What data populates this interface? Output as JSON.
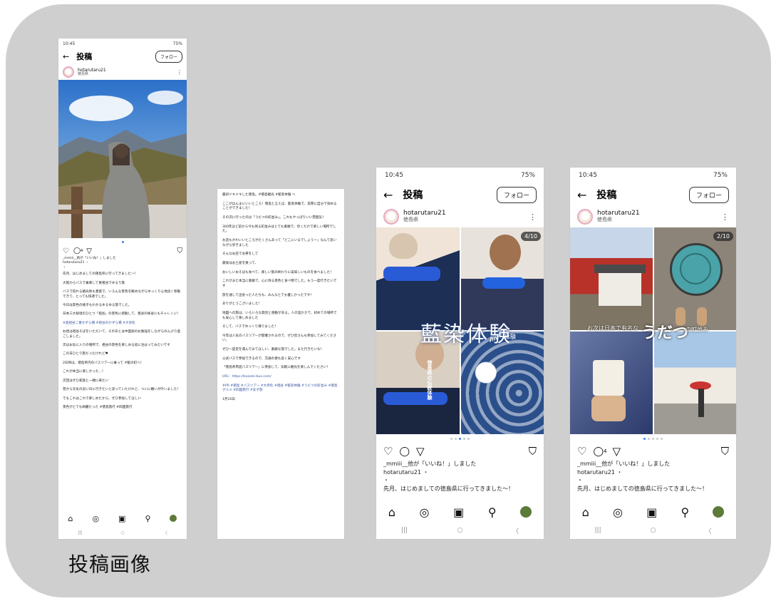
{
  "caption": "投稿画像",
  "p1": {
    "time": "10:45",
    "sys_right": "75%",
    "back": "←",
    "title": "投稿",
    "follow": "フォロー",
    "user": "hotarutaru21",
    "location": "徳島県",
    "more": "⋮",
    "likes": "4",
    "liked_by": "_mmiii__他が「いいね！」しました",
    "author": "hotarutaru21 ・",
    "bullet": "・",
    "lines": [
      "先月、はじめましての徳島県に行ってきました～！",
      "大阪からバスで乗車して東祖谷でゆるり旅",
      "バスで巡れる観光地も豊富で、いろんな景色を眺めながらゆっくり心地良く移動できて、とっても快適でした。",
      "今日は景色の様子もわかるゆるゆる旅でした。",
      "日本三大秘境のひとつ「祖谷」の景色に感動して、祖谷の峡谷にもチャレンジ！",
      "#奥祖谷二重かずら橋 #祖谷のかずら橋 #大歩危",
      "お昼は祖谷そばをいただいて、そのあとは中国語のお勉強をしながらのんびり過ごしました。",
      "次はお気に入りの場所で、祖谷の景色を楽しめる宿に泊まってみたいです",
      "この日ひとり旅だったけれど♥",
      "2日目は、徳島県内のバスツアーに乗って #藍の町へ！",
      "これが本当に楽しかった...！",
      "次回はぜひ家族と一緒に来たい",
      "昔から天気の良い日に行きたいと思っていたけれど、ついに願いが叶いました！",
      "でもこれはこれで楽しめたから、ぜひ参加してほしい",
      "景色がとても綺麗だった #徳島旅行 #四国旅行"
    ]
  },
  "p2": {
    "lines": [
      "最初ドキドキした徳島。#徳島観光 #藍染体験 へ",
      "ここがほんまにいいところ！徳島と言えば、藍染体験で、実際に自分で染めることができました！",
      "その次に行ったのは「うだつの町並み」。これもやっぱりいい雰囲気！",
      "300年ほど前から今も残る町並みはとても素敵で、歩くだけで楽しい場所でした。",
      "お店もかわいいところがたくさんあって「どこにいるでしょう～」なんて思いながら歩きました",
      "そんなお店でお茶をして",
      "最後はお土産を買って、",
      "おいしいおそばも食べて、楽しい旅の終わりに美味しいものを食べました！",
      "これがまた本当に素敵で、心に残る景色と食べ物でした。もう一度行きたいです",
      "旅を通して出会った人たちも、みんなとても優しかったです！",
      "ありがとうございました！",
      "地図への旅は、いろいろな発見と感動がある。人の温かさで、初めての場所でも安心して楽しめました",
      "そして、バスでゆっくり帰りました！",
      "今年は人気のバスツアーが開催されるので、ぜひ皆さんも参加してみてください。",
      "ぜひ一度足を運んでみてほしい、素敵な旅でした。また行きたいな！",
      "公式バスで参加できるので、交通の便も良く安心です",
      "「徳島県周遊バスツアー」に参加して、気軽に観光を楽しんでください！",
      "URL：https://kaiseki-bus.com/",
      "#PR #徳島 #バスツアー #大歩危 #祖谷 #藍染体験 #うだつの町並み #徳島グルメ #四国旅行 #女子旅",
      "1月10日"
    ]
  },
  "p3": {
    "time": "10:45",
    "sys_right": "75%",
    "back": "←",
    "title": "投稿",
    "follow": "フォロー",
    "user": "hotarutaru21",
    "location": "徳島県",
    "more": "⋮",
    "counter": "4/10",
    "overlay_small": "徳島県の伝統体験",
    "overlay_big": "藍染体験",
    "overlay_side": "体験",
    "likes": "",
    "liked_by": "_mmiii__他が「いいね！」しました",
    "author": "hotarutaru21 ・",
    "bullet": "・",
    "caption": "先月、はじめましての徳島県に行ってきました～！"
  },
  "p4": {
    "time": "10:45",
    "sys_right": "75%",
    "back": "←",
    "title": "投稿",
    "follow": "フォロー",
    "user": "hotarutaru21",
    "location": "徳島県",
    "more": "⋮",
    "counter": "2/10",
    "overlay_small": "お次は日本で有名な",
    "overlay_big": "うだつ",
    "overlay_side": "の町並み",
    "likes": "4",
    "liked_by": "_mmiii__他が「いいね！」しました",
    "author": "hotarutaru21 ・",
    "bullet": "・",
    "caption": "先月、はじめましての徳島県に行ってきました～！"
  },
  "icons": {
    "heart": "♡",
    "comment": "◯",
    "send": "▽",
    "bookmark": "⛉",
    "home": "⌂",
    "messenger": "◎",
    "reels": "▣",
    "search": "⚲",
    "recent": "|||",
    "homekey": "○",
    "backkey": "〈"
  },
  "colors": {
    "panel": "#d0cfcf",
    "accent_blue": "#3b82f6",
    "link_blue": "#3a55a4",
    "indigo": "#1d3a7a"
  }
}
